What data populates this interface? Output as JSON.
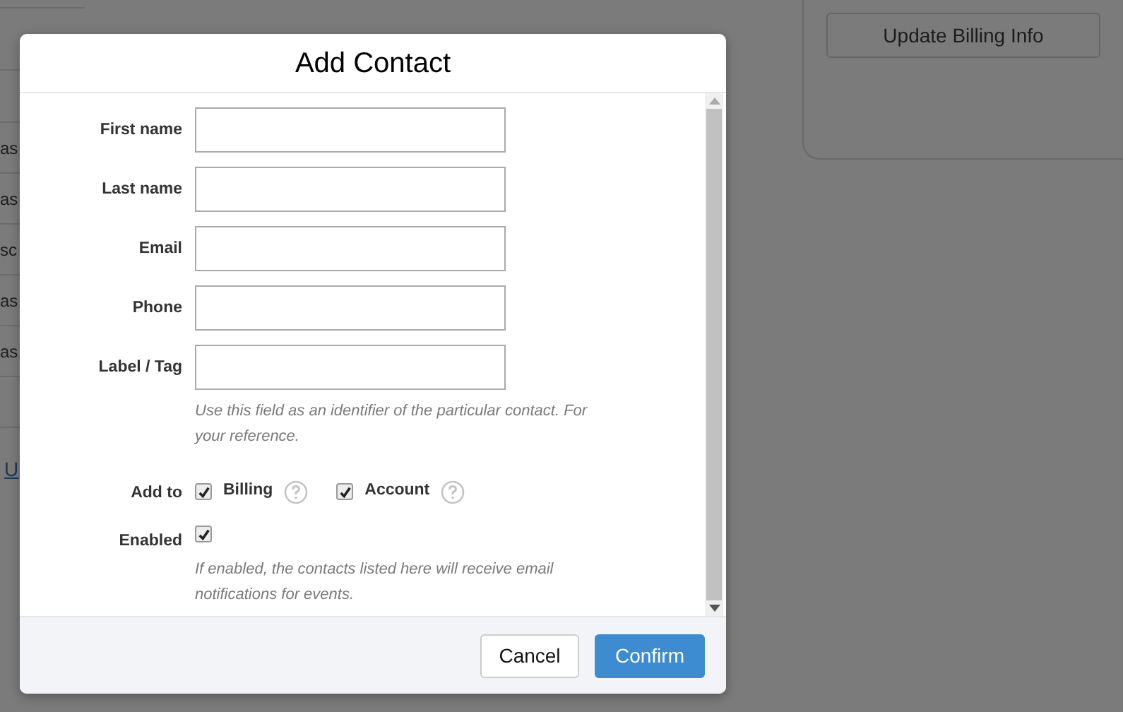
{
  "background": {
    "table_cells": [
      "as",
      "as",
      "sc",
      "as",
      "as"
    ],
    "link": "U",
    "billing_button": "Update Billing Info"
  },
  "dialog": {
    "title": "Add Contact",
    "fields": [
      {
        "label": "First name"
      },
      {
        "label": "Last name"
      },
      {
        "label": "Email"
      },
      {
        "label": "Phone"
      },
      {
        "label": "Label / Tag",
        "hint": "Use this field as an identifier of the particular contact. For your reference."
      }
    ],
    "add_to": {
      "label": "Add to",
      "options": [
        {
          "label": "Billing",
          "checked": true
        },
        {
          "label": "Account",
          "checked": true
        }
      ]
    },
    "enabled": {
      "label": "Enabled",
      "checked": true,
      "hint": "If enabled, the contacts listed here will receive email notifications for events."
    },
    "buttons": [
      {
        "label": "Cancel",
        "kind": "secondary"
      },
      {
        "label": "Confirm",
        "kind": "primary"
      }
    ]
  }
}
